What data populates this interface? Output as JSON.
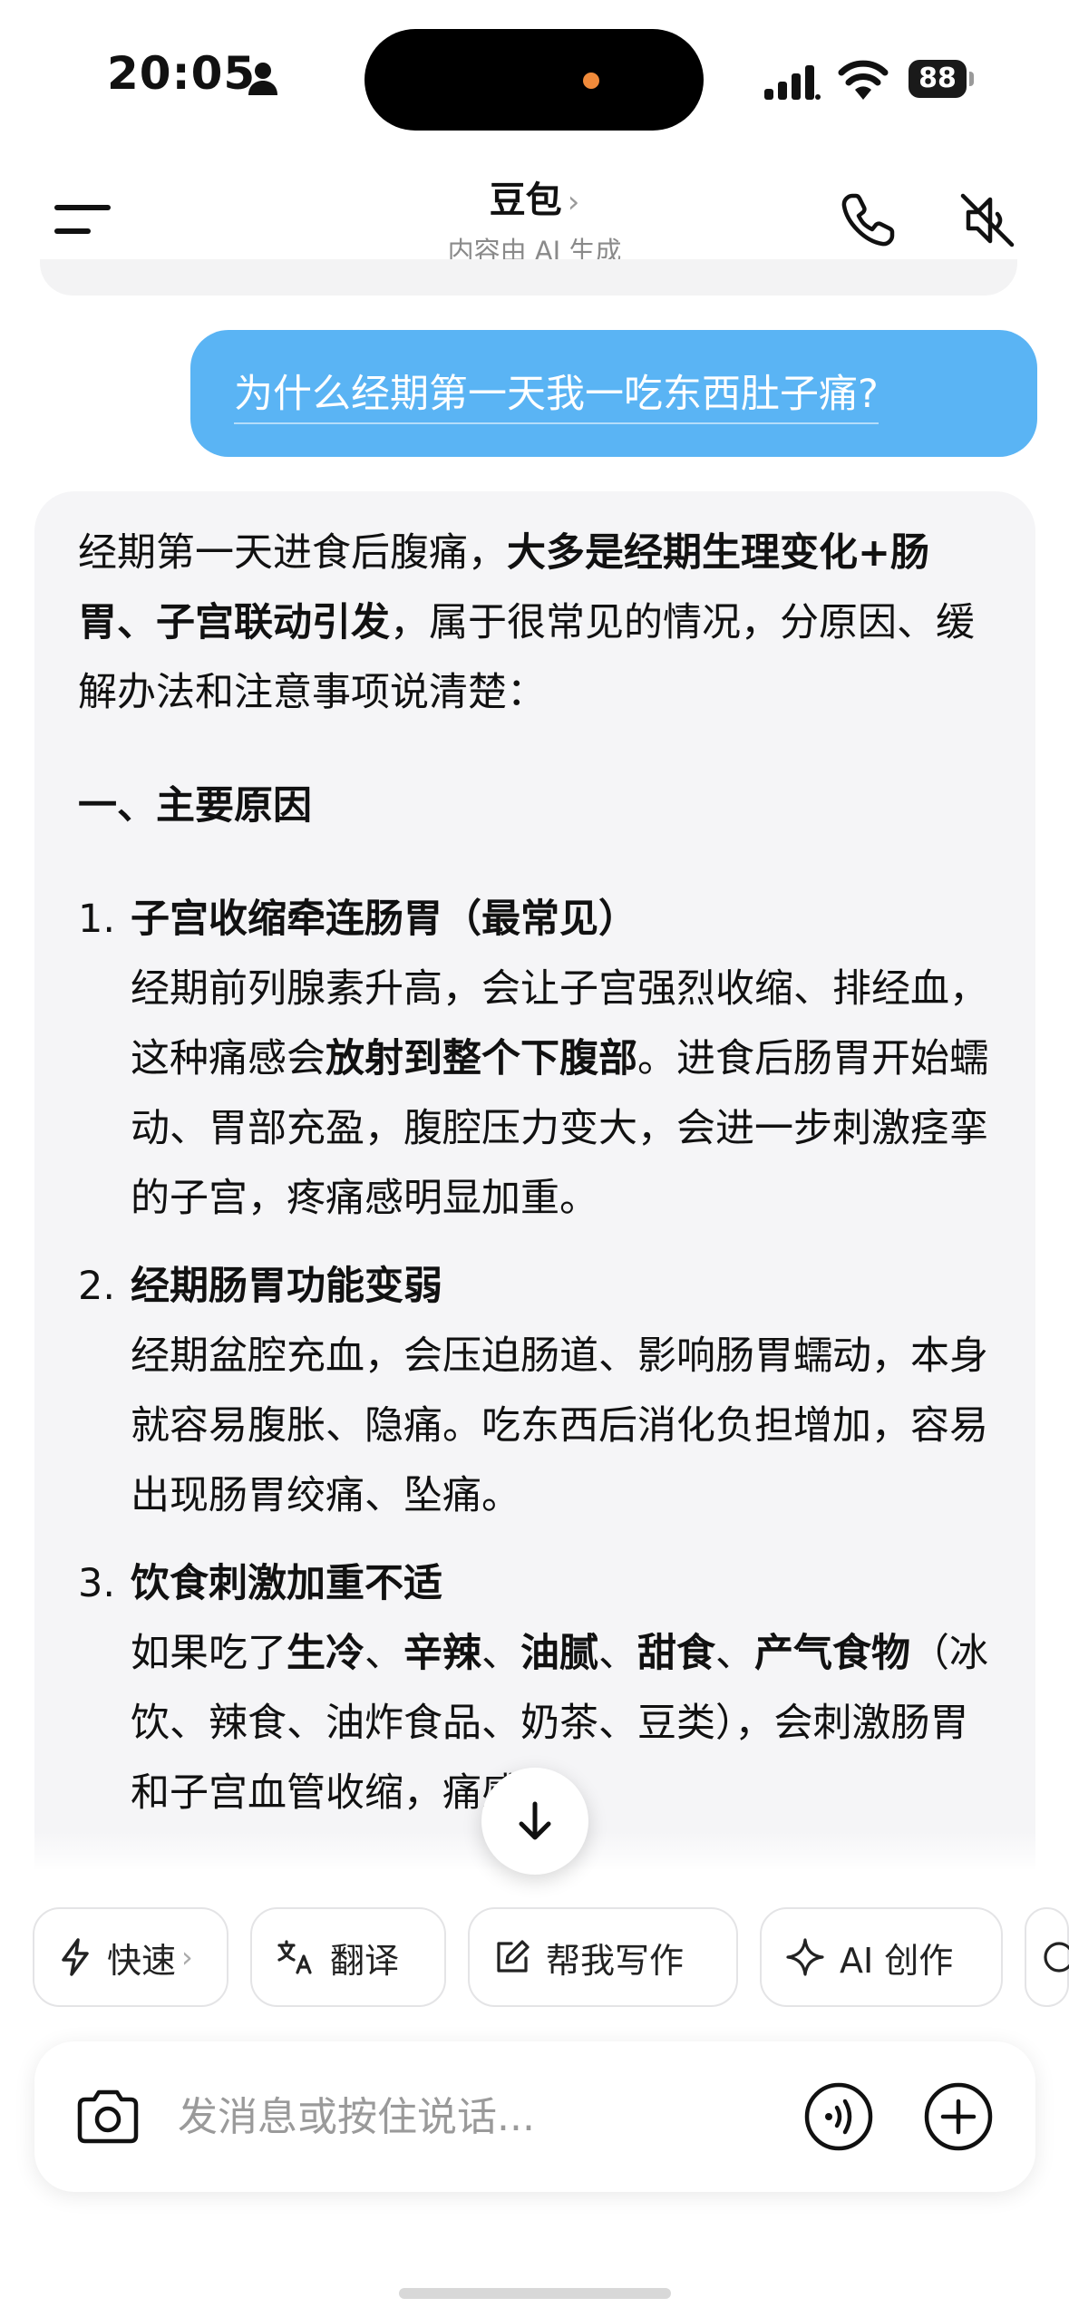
{
  "status_bar": {
    "time": "20:05",
    "battery": "88"
  },
  "header": {
    "title": "豆包",
    "title_chevron": "›",
    "subtitle": "内容由 AI 生成"
  },
  "user_message": "为什么经期第一天我一吃东西肚子痛?",
  "assistant": {
    "intro": {
      "part1": "经期第一天进食后腹痛，",
      "bold": "大多是经期生理变化+肠胃、子宫联动引发",
      "part2": "，属于很常见的情况，分原因、缓解办法和注意事项说清楚："
    },
    "section_heading": "一、主要原因",
    "items": [
      {
        "num": "1.",
        "title": "子宫收缩牵连肠胃（最常见）",
        "body_a": "经期前列腺素升高，会让子宫强烈收缩、排经血，这种痛感会",
        "body_bold": "放射到整个下腹部",
        "body_b": "。进食后肠胃开始蠕动、胃部充盈，腹腔压力变大，会进一步刺激痉挛的子宫，疼痛感明显加重。"
      },
      {
        "num": "2.",
        "title": "经期肠胃功能变弱",
        "body": "经期盆腔充血，会压迫肠道、影响肠胃蠕动，本身就容易腹胀、隐痛。吃东西后消化负担增加，容易出现肠胃绞痛、坠痛。"
      },
      {
        "num": "3.",
        "title": "饮食刺激加重不适",
        "body_a": "如果吃了",
        "bold_1": "生冷",
        "sep_1": "、",
        "bold_2": "辛辣",
        "sep_2": "、",
        "bold_3": "油腻",
        "sep_3": "、",
        "bold_4": "甜食",
        "sep_4": "、",
        "bold_5": "产气食物",
        "body_b": "（冰饮、辣食、油炸食品、奶茶、豆类），会刺激肠胃和子宫血管收缩，痛感会"
      }
    ]
  },
  "quick_actions": [
    {
      "label": "快速",
      "chevron": "›",
      "icon": "lightning-icon"
    },
    {
      "label": "翻译",
      "icon": "translate-icon"
    },
    {
      "label": "帮我写作",
      "icon": "edit-icon"
    },
    {
      "label": "AI 创作",
      "icon": "sparkle-icon"
    }
  ],
  "input": {
    "placeholder": "发消息或按住说话..."
  },
  "colors": {
    "user_bubble": "#5ab4f4",
    "ai_card": "#f5f5f7",
    "island_dot": "#f08a3a"
  }
}
